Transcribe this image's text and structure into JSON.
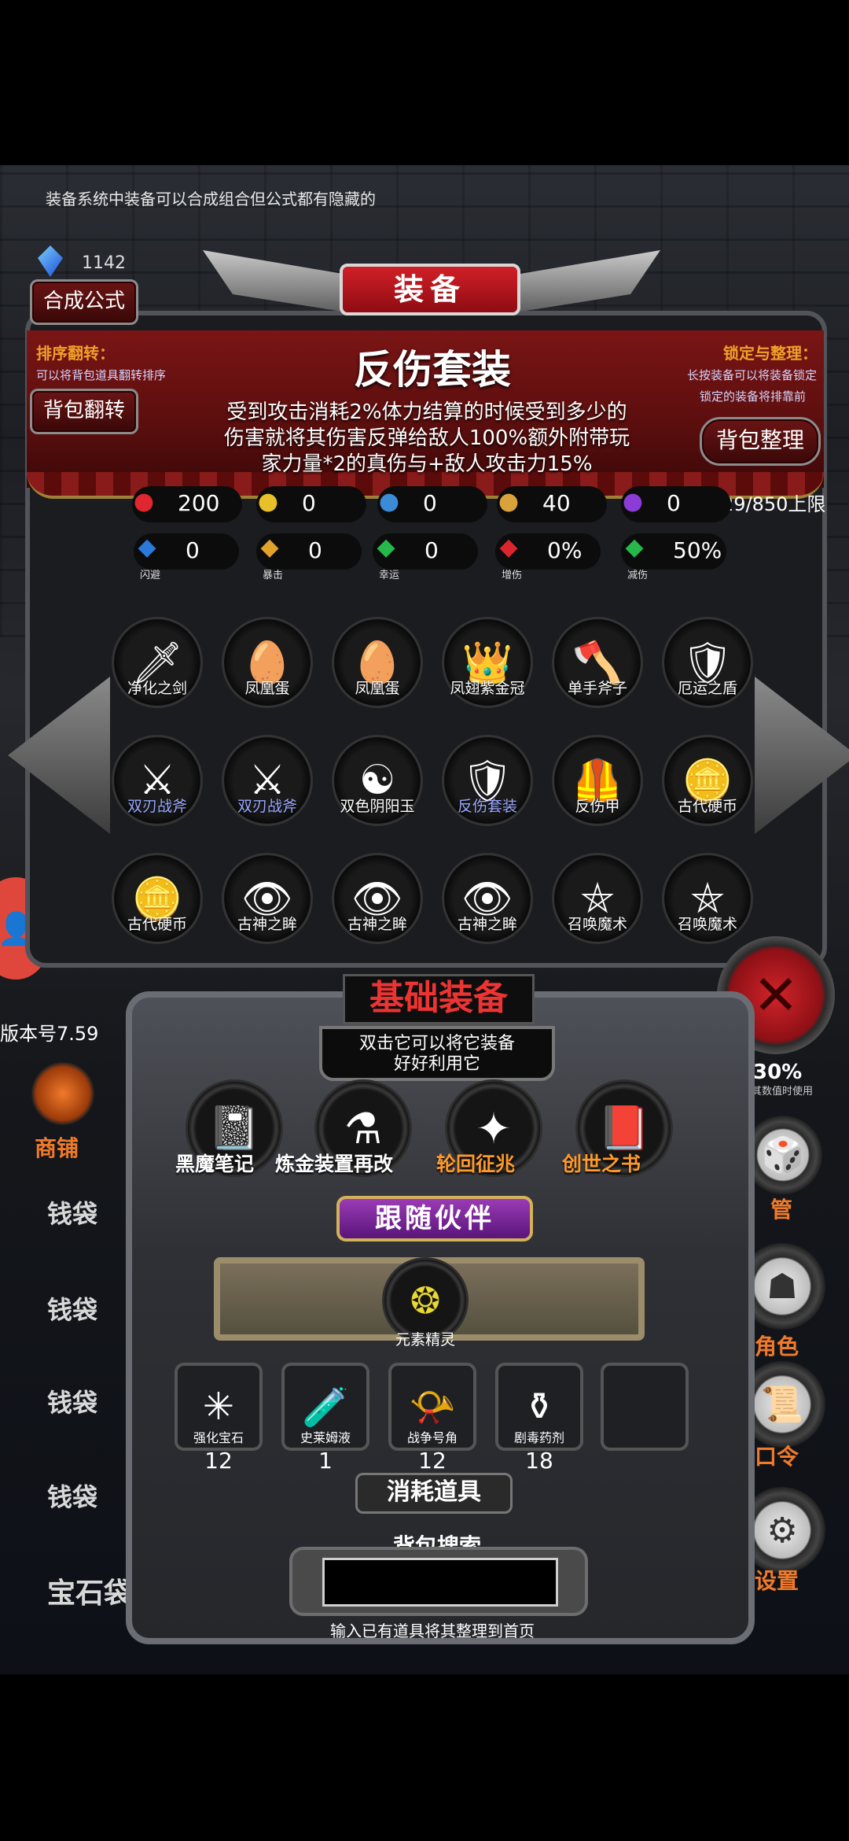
{
  "tip_text": "装备系统中装备可以合成组合但公式都有隐藏的",
  "gem_count": "1142",
  "buttons": {
    "recipe": "合成公式",
    "flip_bag": "背包翻转",
    "organize_bag": "背包整理"
  },
  "window_title": "装备",
  "sort_flip": {
    "label": "排序翻转：",
    "desc": "可以将背包道具翻转排序"
  },
  "lock_organize": {
    "label": "锁定与整理：",
    "desc_line1": "长按装备可以将装备锁定",
    "desc_line2": "锁定的装备将排靠前"
  },
  "set": {
    "title": "反伤套装",
    "line1": "受到攻击消耗2%体力结算的时候受到多少的",
    "line2": "伤害就将其伤害反弹给敌人100%额外附带玩",
    "line3": "家力量*2的真伤与+敌人攻击力15%"
  },
  "capacity": "29/850上限",
  "stats_row1": [
    {
      "icon": "heart-icon",
      "value": "200",
      "color": "#e0262e"
    },
    {
      "icon": "strength-icon",
      "value": "0",
      "color": "#e8c12a"
    },
    {
      "icon": "armor-icon",
      "value": "0",
      "color": "#3b8bd6"
    },
    {
      "icon": "attack-icon",
      "value": "40",
      "color": "#d9a23a"
    },
    {
      "icon": "lightning-icon",
      "value": "0",
      "color": "#8b3bd6"
    }
  ],
  "stats_row2": [
    {
      "icon": "dodge-icon",
      "name": "闪避",
      "value": "0",
      "color": "#2a7ad9"
    },
    {
      "icon": "crit-icon",
      "name": "暴击",
      "value": "0",
      "color": "#e0a22a"
    },
    {
      "icon": "luck-icon",
      "name": "幸运",
      "value": "0",
      "color": "#26b84a"
    },
    {
      "icon": "damage-up-icon",
      "name": "增伤",
      "value": "0%",
      "color": "#d9262e"
    },
    {
      "icon": "damage-reduce-icon",
      "name": "减伤",
      "value": "50%",
      "color": "#26b84a"
    }
  ],
  "items": [
    {
      "name": "净化之剑",
      "icon": "sword-icon",
      "glyph": "🗡",
      "blue": false
    },
    {
      "name": "凤凰蛋",
      "icon": "egg-icon",
      "glyph": "🥚",
      "blue": false
    },
    {
      "name": "凤凰蛋",
      "icon": "egg-icon",
      "glyph": "🥚",
      "blue": false
    },
    {
      "name": "凤翅紫金冠",
      "icon": "crown-icon",
      "glyph": "👑",
      "blue": false
    },
    {
      "name": "单手斧子",
      "icon": "axe-icon",
      "glyph": "🪓",
      "blue": false
    },
    {
      "name": "厄运之盾",
      "icon": "shield-icon",
      "glyph": "🛡",
      "blue": false
    },
    {
      "name": "双刃战斧",
      "icon": "battle-axe-icon",
      "glyph": "⚔",
      "blue": true
    },
    {
      "name": "双刃战斧",
      "icon": "battle-axe-icon",
      "glyph": "⚔",
      "blue": true
    },
    {
      "name": "双色阴阳玉",
      "icon": "yin-yang-jade-icon",
      "glyph": "☯",
      "blue": false
    },
    {
      "name": "反伤套装",
      "icon": "armor-set-icon",
      "glyph": "🛡",
      "blue": true
    },
    {
      "name": "反伤甲",
      "icon": "thorn-armor-icon",
      "glyph": "🦺",
      "blue": false
    },
    {
      "name": "古代硬币",
      "icon": "coin-icon",
      "glyph": "🪙",
      "blue": false
    },
    {
      "name": "古代硬币",
      "icon": "coin-icon",
      "glyph": "🪙",
      "blue": false
    },
    {
      "name": "古神之眸",
      "icon": "eye-icon",
      "glyph": "👁",
      "blue": false
    },
    {
      "name": "古神之眸",
      "icon": "eye-icon",
      "glyph": "👁",
      "blue": false
    },
    {
      "name": "古神之眸",
      "icon": "eye-icon",
      "glyph": "👁",
      "blue": false
    },
    {
      "name": "召唤魔术",
      "icon": "pentagram-icon",
      "glyph": "⛤",
      "blue": false
    },
    {
      "name": "召唤魔术",
      "icon": "pentagram-icon",
      "glyph": "⛤",
      "blue": false
    }
  ],
  "base_equipment": {
    "title": "基础装备",
    "sub_line1": "双击它可以将它装备",
    "sub_line2": "好好利用它",
    "slots": [
      {
        "name": "黑魔笔记",
        "icon": "notebook-icon",
        "glyph": "📓",
        "style": "white"
      },
      {
        "name": "炼金装置再改",
        "icon": "alchemy-icon",
        "glyph": "⚗",
        "style": "white"
      },
      {
        "name": "轮回征兆",
        "icon": "staff-icon",
        "glyph": "✦",
        "style": "gold"
      },
      {
        "name": "创世之书",
        "icon": "book-icon",
        "glyph": "📕",
        "style": "gold"
      }
    ]
  },
  "companion": {
    "title": "跟随伙伴",
    "name": "元素精灵"
  },
  "consumables": {
    "title": "消耗道具",
    "slots": [
      {
        "name": "强化宝石",
        "icon": "gem-icon",
        "glyph": "✳",
        "count": "12"
      },
      {
        "name": "史莱姆液",
        "icon": "potion-icon",
        "glyph": "🧪",
        "count": "1"
      },
      {
        "name": "战争号角",
        "icon": "horn-icon",
        "glyph": "📯",
        "count": "12"
      },
      {
        "name": "剧毒药剂",
        "icon": "poison-icon",
        "glyph": "⚱",
        "count": "18"
      }
    ]
  },
  "search": {
    "title": "背包搜索",
    "placeholder": "",
    "hint": "输入已有道具将其整理到首页"
  },
  "left_panel": {
    "version": "版本号7.59",
    "shop": "商铺",
    "rows": [
      "钱袋",
      "钱袋",
      "钱袋",
      "钱袋"
    ],
    "gem_bag": "宝石袋子里面装了"
  },
  "right_panel": {
    "percent_text": "30%",
    "percent_sub": "其数值时使用",
    "manage": "管",
    "role": "角色",
    "code": "口令",
    "settings": "设置"
  }
}
